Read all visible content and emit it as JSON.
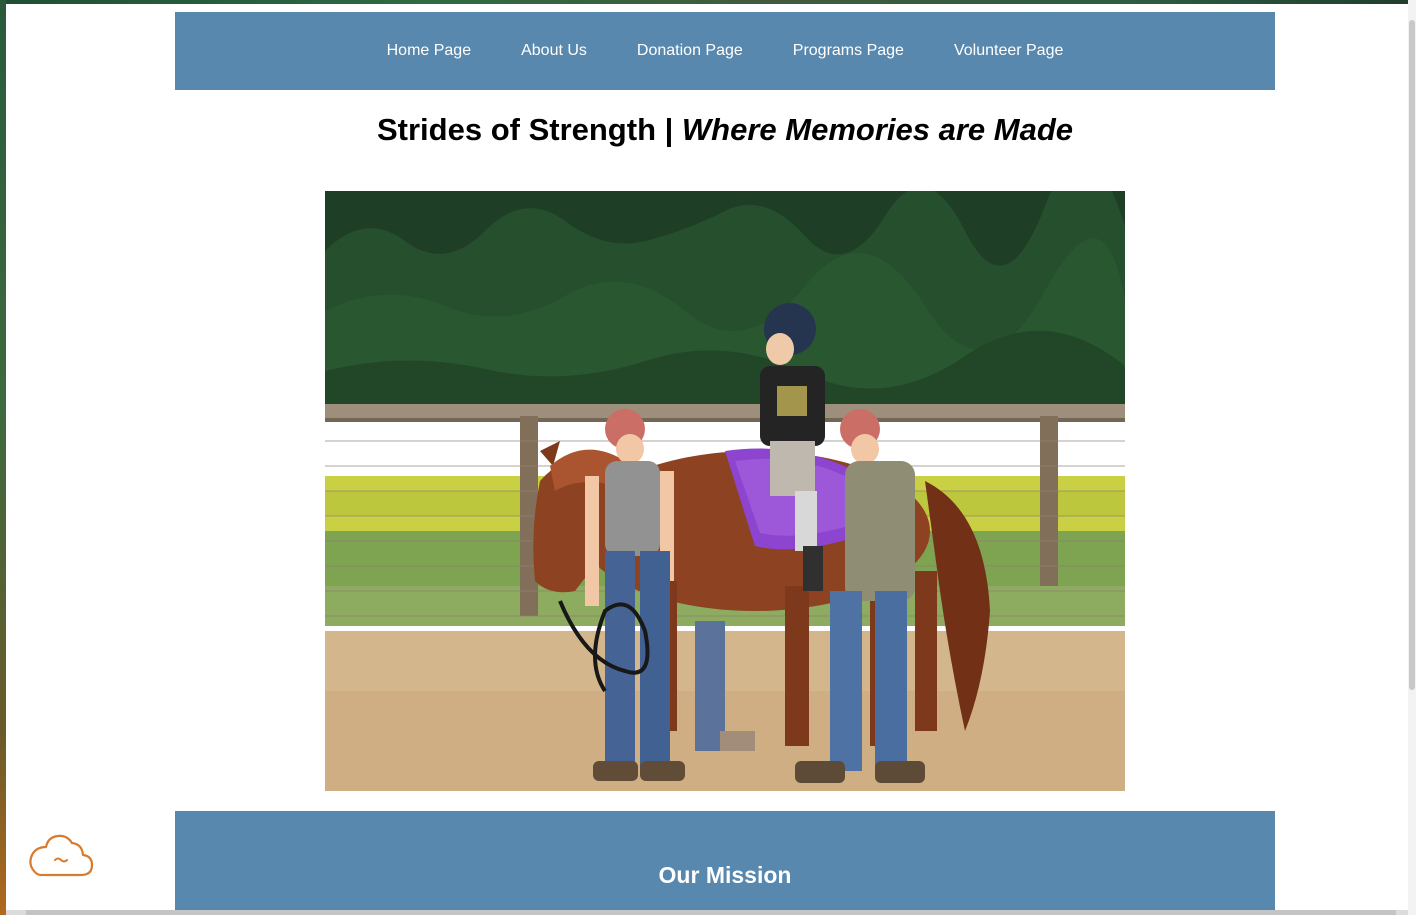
{
  "nav": {
    "items": [
      {
        "label": "Home Page"
      },
      {
        "label": "About Us"
      },
      {
        "label": "Donation Page"
      },
      {
        "label": "Programs Page"
      },
      {
        "label": "Volunteer Page"
      }
    ]
  },
  "header": {
    "title_main": "Strides of Strength | ",
    "title_tagline": "Where Memories are Made"
  },
  "hero": {
    "image": "child riding a chestnut horse led by volunteers"
  },
  "mission": {
    "heading": "Our Mission"
  },
  "widgets": {
    "chat_icon": "cloud-chat-icon"
  },
  "colors": {
    "nav_background": "#5888ae",
    "mission_background": "#5888ae",
    "cloud_accent": "#d97b2e"
  }
}
